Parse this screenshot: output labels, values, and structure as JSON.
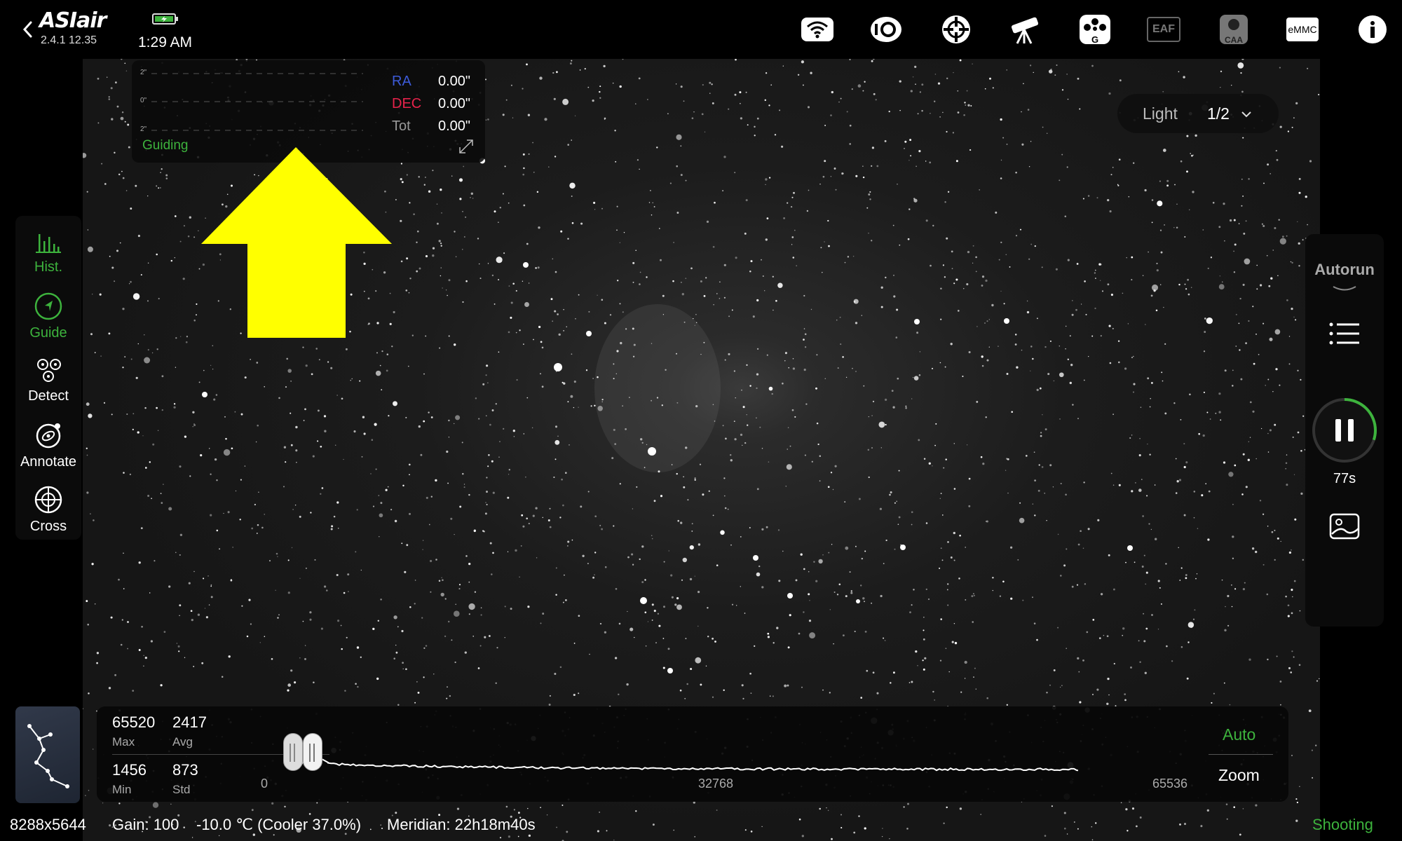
{
  "app": {
    "name": "ASIair",
    "version": "2.4.1 12.35",
    "time": "1:29 AM"
  },
  "toolbar": {
    "icons": [
      "wifi-icon",
      "camera-icon",
      "guide-camera-icon",
      "mount-icon",
      "filter-wheel-icon",
      "eaf-icon",
      "caa-icon",
      "emmc-icon",
      "info-icon"
    ],
    "eaf_label": "EAF",
    "caa_label": "CAA",
    "emmc_label": "eMMC",
    "filter_label": "G"
  },
  "sidebar": {
    "items": [
      {
        "label": "Hist.",
        "icon": "histogram-icon",
        "active": true
      },
      {
        "label": "Guide",
        "icon": "guide-icon",
        "active": true
      },
      {
        "label": "Detect",
        "icon": "detect-icon",
        "active": false
      },
      {
        "label": "Annotate",
        "icon": "annotate-icon",
        "active": false
      },
      {
        "label": "Cross",
        "icon": "crosshair-icon",
        "active": false
      }
    ]
  },
  "guide_panel": {
    "scale_top": "2\"",
    "scale_mid": "0\"",
    "scale_bottom": "2\"",
    "ra_label": "RA",
    "ra_value": "0.00\"",
    "dec_label": "DEC",
    "dec_value": "0.00\"",
    "tot_label": "Tot",
    "tot_value": "0.00\"",
    "status": "Guiding",
    "colors": {
      "ra": "#3d5bd9",
      "dec": "#e8234b",
      "status": "#3db33d"
    }
  },
  "frame_select": {
    "type": "Light",
    "count": "1/2"
  },
  "rightbar": {
    "autorun_label": "Autorun",
    "exposure_remaining": "77s",
    "exposure_progress": 0.3
  },
  "histogram": {
    "max_value": "65520",
    "max_label": "Max",
    "avg_value": "2417",
    "avg_label": "Avg",
    "min_value": "1456",
    "min_label": "Min",
    "std_value": "873",
    "std_label": "Std",
    "axis_min": "0",
    "axis_mid": "32768",
    "axis_max": "65536",
    "auto_label": "Auto",
    "zoom_label": "Zoom"
  },
  "status": {
    "resolution": "8288x5644",
    "gain": "Gain: 100",
    "temperature": "-10.0 ℃ (Cooler 37.0%)",
    "meridian": "Meridian: 22h18m40s",
    "state": "Shooting"
  },
  "annotation": {
    "arrow_color": "#ffff00"
  }
}
